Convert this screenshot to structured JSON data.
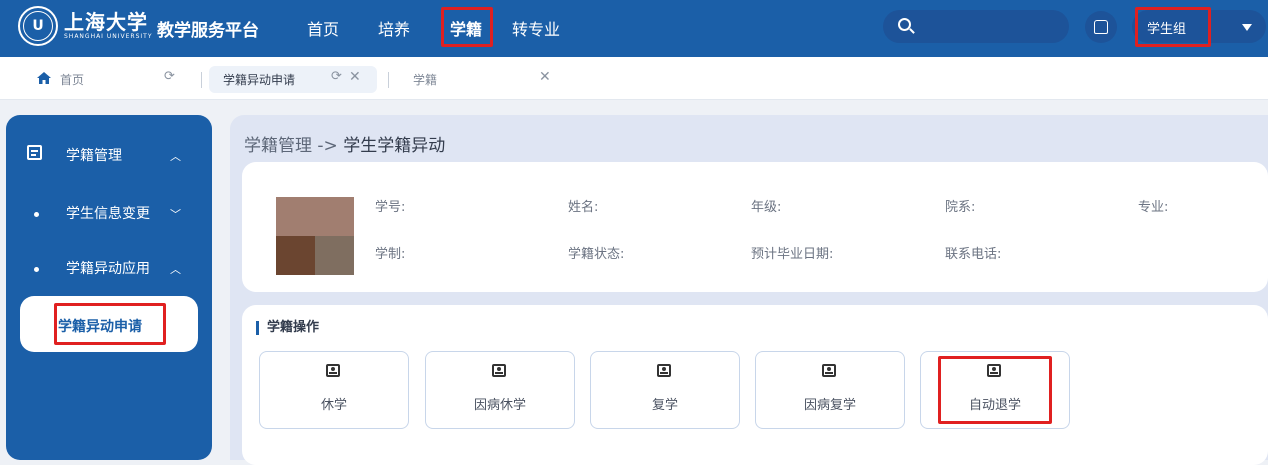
{
  "header": {
    "logo_cn": "上海大学",
    "logo_en": "SHANGHAI UNIVERSITY",
    "system_title": "教学服务平台",
    "nav": [
      {
        "label": "首页"
      },
      {
        "label": "培养"
      },
      {
        "label": "学籍",
        "active": true
      },
      {
        "label": "转专业"
      }
    ],
    "search_placeholder": "",
    "role": "学生组",
    "colors": {
      "bar": "#1b5fa8",
      "highlight": "#e02020"
    }
  },
  "tabs": {
    "home_label": "首页",
    "open": [
      {
        "label": "学籍异动申请",
        "active": true
      },
      {
        "label": "学籍",
        "active": false
      }
    ]
  },
  "sidebar": {
    "section": "学籍管理",
    "groups": [
      {
        "label": "学生信息变更",
        "expanded": false
      },
      {
        "label": "学籍异动应用",
        "expanded": true
      }
    ],
    "active_item": "学籍异动申请"
  },
  "main": {
    "breadcrumb_prefix": "学籍管理 ->",
    "title": "学生学籍异动",
    "info_fields": {
      "student_id": "学号:",
      "name": "姓名:",
      "grade": "年级:",
      "department": "院系:",
      "major": "专业:",
      "program_length": "学制:",
      "status": "学籍状态:",
      "expected_graduation": "预计毕业日期:",
      "phone": "联系电话:"
    },
    "operations_title": "学籍操作",
    "operations": [
      {
        "label": "休学"
      },
      {
        "label": "因病休学"
      },
      {
        "label": "复学"
      },
      {
        "label": "因病复学"
      },
      {
        "label": "自动退学",
        "highlighted": true
      }
    ]
  }
}
